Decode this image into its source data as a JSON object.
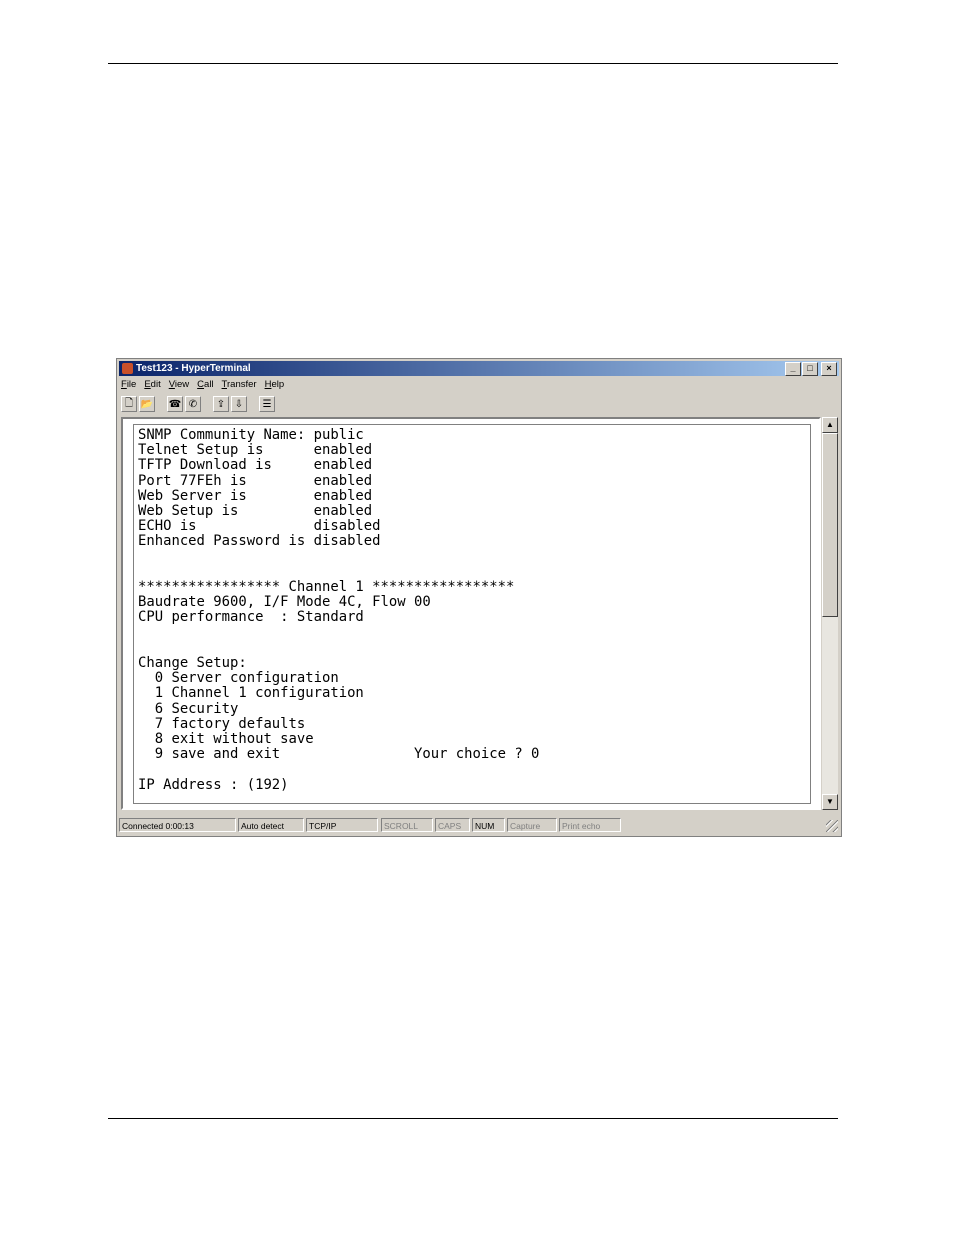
{
  "window": {
    "title": "Test123 - HyperTerminal",
    "controls": {
      "minimize": "_",
      "maximize": "□",
      "close": "×"
    }
  },
  "menu": [
    {
      "key": "F",
      "rest": "ile"
    },
    {
      "key": "E",
      "rest": "dit"
    },
    {
      "key": "V",
      "rest": "iew"
    },
    {
      "key": "C",
      "rest": "all"
    },
    {
      "key": "T",
      "rest": "ransfer"
    },
    {
      "key": "H",
      "rest": "elp"
    }
  ],
  "toolbar": {
    "new": "🗋",
    "open": "📂",
    "connect": "☎",
    "disconnect": "✆",
    "send": "⇪",
    "receive": "⇩",
    "properties": "☰"
  },
  "terminal": {
    "lines": [
      "SNMP Community Name: public",
      "Telnet Setup is      enabled",
      "TFTP Download is     enabled",
      "Port 77FEh is        enabled",
      "Web Server is        enabled",
      "Web Setup is         enabled",
      "ECHO is              disabled",
      "Enhanced Password is disabled",
      "",
      "",
      "***************** Channel 1 *****************",
      "Baudrate 9600, I/F Mode 4C, Flow 00",
      "CPU performance  : Standard",
      "",
      "",
      "Change Setup:",
      "  0 Server configuration",
      "  1 Channel 1 configuration",
      "  6 Security",
      "  7 factory defaults",
      "  8 exit without save",
      "  9 save and exit                Your choice ? 0",
      "",
      "IP Address : (192)"
    ]
  },
  "scrollbar": {
    "up": "▲",
    "down": "▼"
  },
  "status": {
    "connected": "Connected 0:00:13",
    "detect": "Auto detect",
    "protocol": "TCP/IP",
    "scroll": "SCROLL",
    "caps": "CAPS",
    "num": "NUM",
    "capture": "Capture",
    "print_echo": "Print echo"
  }
}
